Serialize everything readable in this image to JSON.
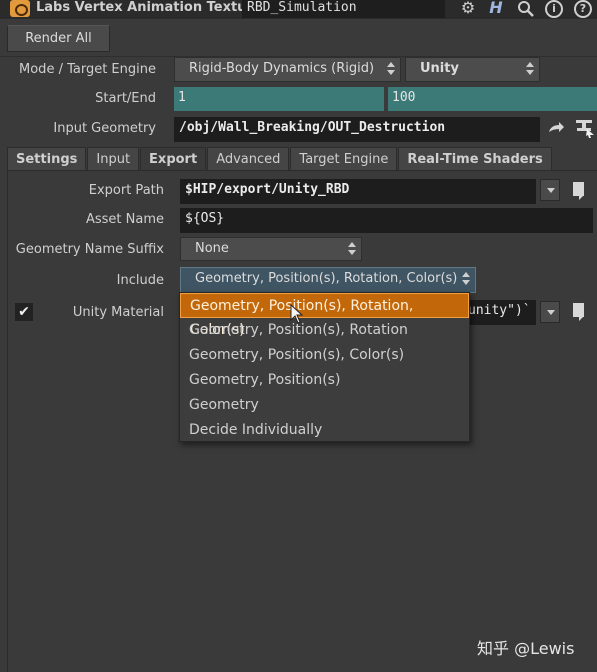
{
  "header": {
    "node_type": "Labs Vertex Animation Textures",
    "node_name": "RBD_Simulation",
    "icons": [
      "gear-icon",
      "help-h-icon",
      "search-icon",
      "info-icon",
      "question-icon"
    ],
    "gear_glyph": "⚙",
    "h_glyph": "H",
    "search_glyph": "🔍",
    "info_glyph": "i",
    "help_glyph": "?"
  },
  "render_all": "Render All",
  "params": {
    "mode": {
      "label": "Mode / Target Engine",
      "value": "Rigid-Body Dynamics (Rigid)",
      "engine": "Unity"
    },
    "start_end": {
      "label": "Start/End",
      "start": "1",
      "end": "100"
    },
    "input_geometry": {
      "label": "Input Geometry",
      "value": "/obj/Wall_Breaking/OUT_Destruction"
    }
  },
  "tabs": [
    {
      "label": "Settings",
      "bold": true
    },
    {
      "label": "Input",
      "bold": false
    },
    {
      "label": "Export",
      "bold": true,
      "active": true
    },
    {
      "label": "Advanced",
      "bold": false
    },
    {
      "label": "Target Engine",
      "bold": false
    },
    {
      "label": "Real-Time Shaders",
      "bold": true
    }
  ],
  "export": {
    "export_path": {
      "label": "Export Path",
      "value": "$HIP/export/Unity_RBD"
    },
    "asset_name": {
      "label": "Asset Name",
      "value": "${OS}"
    },
    "geo_suffix": {
      "label": "Geometry Name Suffix",
      "value": "None"
    },
    "include": {
      "label": "Include",
      "value": "Geometry, Position(s), Rotation, Color(s)"
    },
    "unity_material": {
      "label": "Unity Material",
      "checked": true,
      "check_glyph": "✔",
      "value_tail": "unity\")`"
    }
  },
  "dropdown": {
    "options": [
      "Geometry, Position(s), Rotation, Color(s)",
      "Geometry, Position(s), Rotation",
      "Geometry, Position(s), Color(s)",
      "Geometry, Position(s)",
      "Geometry",
      "Decide Individually"
    ],
    "selected_index": 0,
    "highlight_color": "#c2680b"
  },
  "watermark": "知乎 @Lewis"
}
